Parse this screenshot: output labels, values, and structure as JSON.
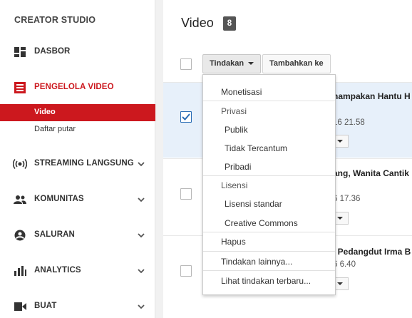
{
  "sidebar": {
    "title": "CREATOR STUDIO",
    "items": [
      {
        "label": "DASBOR",
        "icon": "dashboard-icon"
      },
      {
        "label": "PENGELOLA VIDEO",
        "icon": "video-manager-icon",
        "active": true
      },
      {
        "label": "STREAMING LANGSUNG",
        "icon": "live-stream-icon"
      },
      {
        "label": "KOMUNITAS",
        "icon": "community-icon"
      },
      {
        "label": "SALURAN",
        "icon": "channel-icon"
      },
      {
        "label": "ANALYTICS",
        "icon": "analytics-icon"
      },
      {
        "label": "BUAT",
        "icon": "create-video-icon"
      }
    ],
    "subitems": [
      {
        "label": "Video",
        "selected": true
      },
      {
        "label": "Daftar putar"
      }
    ]
  },
  "main": {
    "title": "Video",
    "count": "8",
    "actions_label": "Tindakan",
    "add_to_label": "Tambahkan ke",
    "rows": [
      {
        "title": "nampakan Hantu H",
        "time": "16 21.58",
        "checked": true
      },
      {
        "title": "ang, Wanita Cantik",
        "time": "6 17.36",
        "checked": false
      },
      {
        "title": "i Pedangdut Irma B",
        "time": "6 6.40",
        "checked": false
      }
    ]
  },
  "dropdown": {
    "monetize": "Monetisasi",
    "privacy_header": "Privasi",
    "privacy_options": [
      "Publik",
      "Tidak Tercantum",
      "Pribadi"
    ],
    "license_header": "Lisensi",
    "license_options": [
      "Lisensi standar",
      "Creative Commons"
    ],
    "delete": "Hapus",
    "more": "Tindakan lainnya...",
    "recent": "Lihat tindakan terbaru..."
  },
  "colors": {
    "accent_red": "#cc181e",
    "selected_row": "#e7f0fa",
    "checkbox_blue": "#2c6eb5"
  }
}
